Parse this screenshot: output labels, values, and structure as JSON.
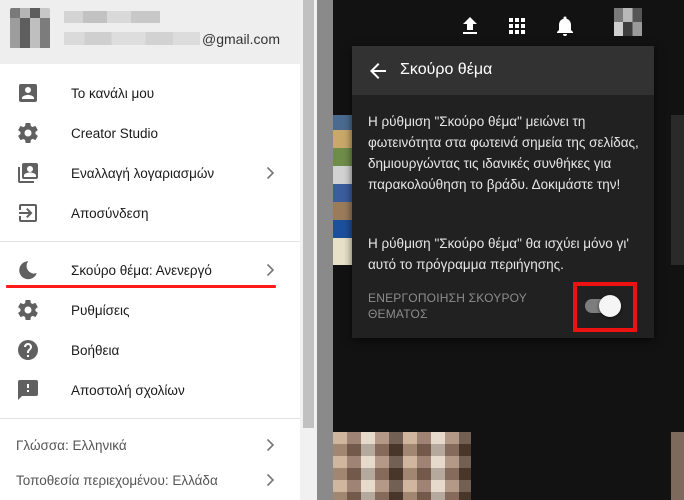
{
  "account": {
    "email_suffix": "@gmail.com"
  },
  "menu": {
    "group1": [
      {
        "label": "Το κανάλι μου",
        "icon": "account-box-icon"
      },
      {
        "label": "Creator Studio",
        "icon": "gear-icon"
      },
      {
        "label": "Εναλλαγή λογαριασμών",
        "icon": "switch-accounts-icon",
        "chevron": true
      },
      {
        "label": "Αποσύνδεση",
        "icon": "sign-out-icon"
      }
    ],
    "group2": [
      {
        "label": "Σκούρο θέμα: Ανενεργό",
        "icon": "moon-icon",
        "chevron": true
      },
      {
        "label": "Ρυθμίσεις",
        "icon": "gear-icon"
      },
      {
        "label": "Βοήθεια",
        "icon": "help-icon"
      },
      {
        "label": "Αποστολή σχολίων",
        "icon": "feedback-icon"
      }
    ],
    "group3": [
      {
        "label": "Γλώσσα: Ελληνικά",
        "chevron": true
      },
      {
        "label": "Τοποθεσία περιεχομένου: Ελλάδα",
        "chevron": true
      }
    ]
  },
  "topbar": {
    "icons": [
      "upload-icon",
      "apps-icon",
      "bell-icon"
    ]
  },
  "dark_theme_panel": {
    "title": "Σκούρο θέμα",
    "description": "Η ρύθμιση \"Σκούρο θέμα\" μειώνει τη φωτεινότητα στα φωτεινά σημεία της σελίδας, δημιουργώντας τις ιδανικές συνθήκες για παρακολούθηση το βράδυ. Δοκιμάστε την!",
    "note": "Η ρύθμιση \"Σκούρο θέμα\" θα ισχύει μόνο γι' αυτό το πρόγραμμα περιήγησης.",
    "toggle_label": "ΕΝΕΡΓΟΠΟΙΗΣΗ ΣΚΟΥΡΟΥ ΘΕΜΑΤΟΣ",
    "toggle_on": false
  },
  "colors": {
    "highlight": "#ee1111",
    "panel_bg": "#212121",
    "panel_header": "#323232"
  }
}
